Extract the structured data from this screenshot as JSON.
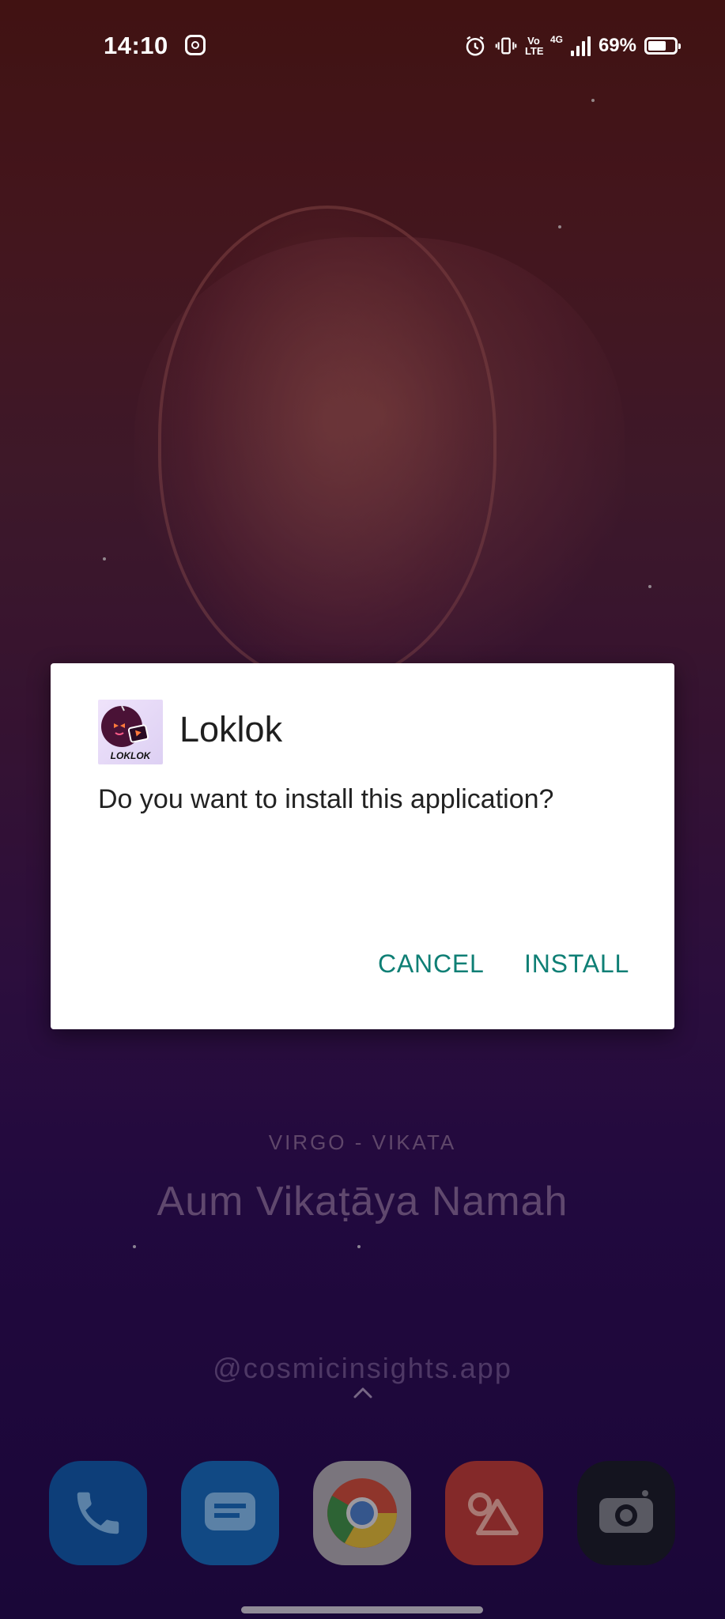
{
  "status_bar": {
    "time": "14:10",
    "battery_percent": "69%",
    "battery_level": 0.69,
    "network": "4G",
    "volte": "Vo LTE",
    "icons": [
      "instagram-icon",
      "alarm-icon",
      "vibrate-icon",
      "volte-icon",
      "signal-icon",
      "battery-icon"
    ]
  },
  "dialog": {
    "app_name": "Loklok",
    "app_icon_label": "LOKLOK",
    "question": "Do you want to install this application?",
    "cancel_label": "CANCEL",
    "install_label": "INSTALL",
    "accent_color": "#0f7f75"
  },
  "wallpaper": {
    "zodiac": "VIRGO - VIKATA",
    "mantra": "Aum Vikaṭāya Namah",
    "handle": "@cosmicinsights.app"
  },
  "dock": {
    "apps": [
      "phone",
      "messages",
      "chrome",
      "gallery",
      "camera"
    ]
  }
}
